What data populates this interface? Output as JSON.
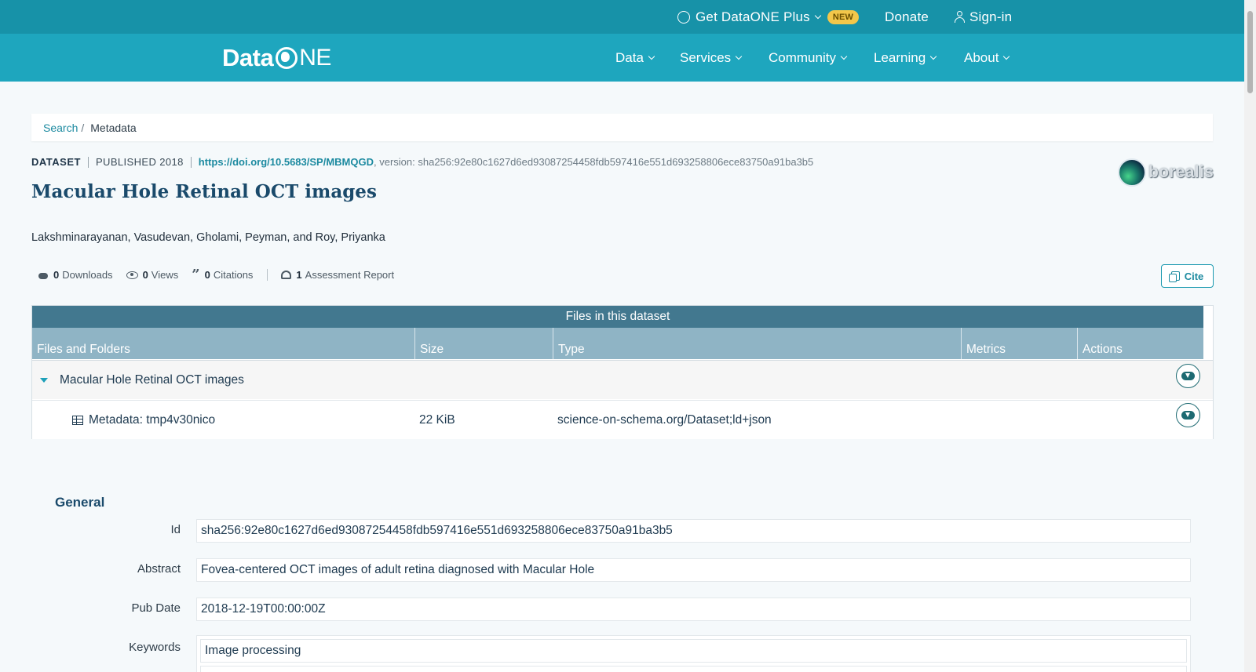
{
  "topbar": {
    "plus_label": "Get DataONE Plus",
    "new_badge": "NEW",
    "donate_label": "Donate",
    "signin_label": "Sign-in"
  },
  "navbar": {
    "logo_left": "Data",
    "logo_right": "NE",
    "items": [
      {
        "label": "Data"
      },
      {
        "label": "Services"
      },
      {
        "label": "Community"
      },
      {
        "label": "Learning"
      },
      {
        "label": "About"
      }
    ]
  },
  "breadcrumb": {
    "search": "Search",
    "separator": "/",
    "current": "Metadata"
  },
  "dataset": {
    "type": "DATASET",
    "published": "PUBLISHED 2018",
    "doi": "https://doi.org/10.5683/SP/MBMQGD",
    "version_text": ", version: sha256:92e80c1627d6ed93087254458fdb597416e551d693258806ece83750a91ba3b5",
    "title": "Macular Hole Retinal OCT images",
    "authors": "Lakshminarayanan, Vasudevan, Gholami, Peyman, and Roy, Priyanka",
    "repository": "borealis"
  },
  "metrics": {
    "downloads_count": "0",
    "downloads_label": "Downloads",
    "views_count": "0",
    "views_label": "Views",
    "citations_count": "0",
    "citations_label": "Citations",
    "assessment_count": "1",
    "assessment_label": "Assessment Report"
  },
  "cite_label": "Cite",
  "files": {
    "caption": "Files in this dataset",
    "headers": [
      "Files and Folders",
      "Size",
      "Type",
      "Metrics",
      "Actions"
    ],
    "folder_name": "Macular Hole Retinal OCT images",
    "rows": [
      {
        "name": "Metadata: tmp4v30nico",
        "size": "22 KiB",
        "type": "science-on-schema.org/Dataset;ld+json"
      }
    ]
  },
  "general": {
    "title": "General",
    "id_label": "Id",
    "id_value": "sha256:92e80c1627d6ed93087254458fdb597416e551d693258806ece83750a91ba3b5",
    "abstract_label": "Abstract",
    "abstract_value": "Fovea-centered OCT images of adult retina diagnosed with Macular Hole",
    "pubdate_label": "Pub Date",
    "pubdate_value": "2018-12-19T00:00:00Z",
    "keywords_label": "Keywords",
    "keywords": [
      "Image processing"
    ]
  },
  "colors": {
    "topbar": "#1792a8",
    "navbar": "#1ea6be",
    "accent": "#1c8aa0",
    "table_caption": "#42788f",
    "table_header": "#8fb4c5"
  }
}
